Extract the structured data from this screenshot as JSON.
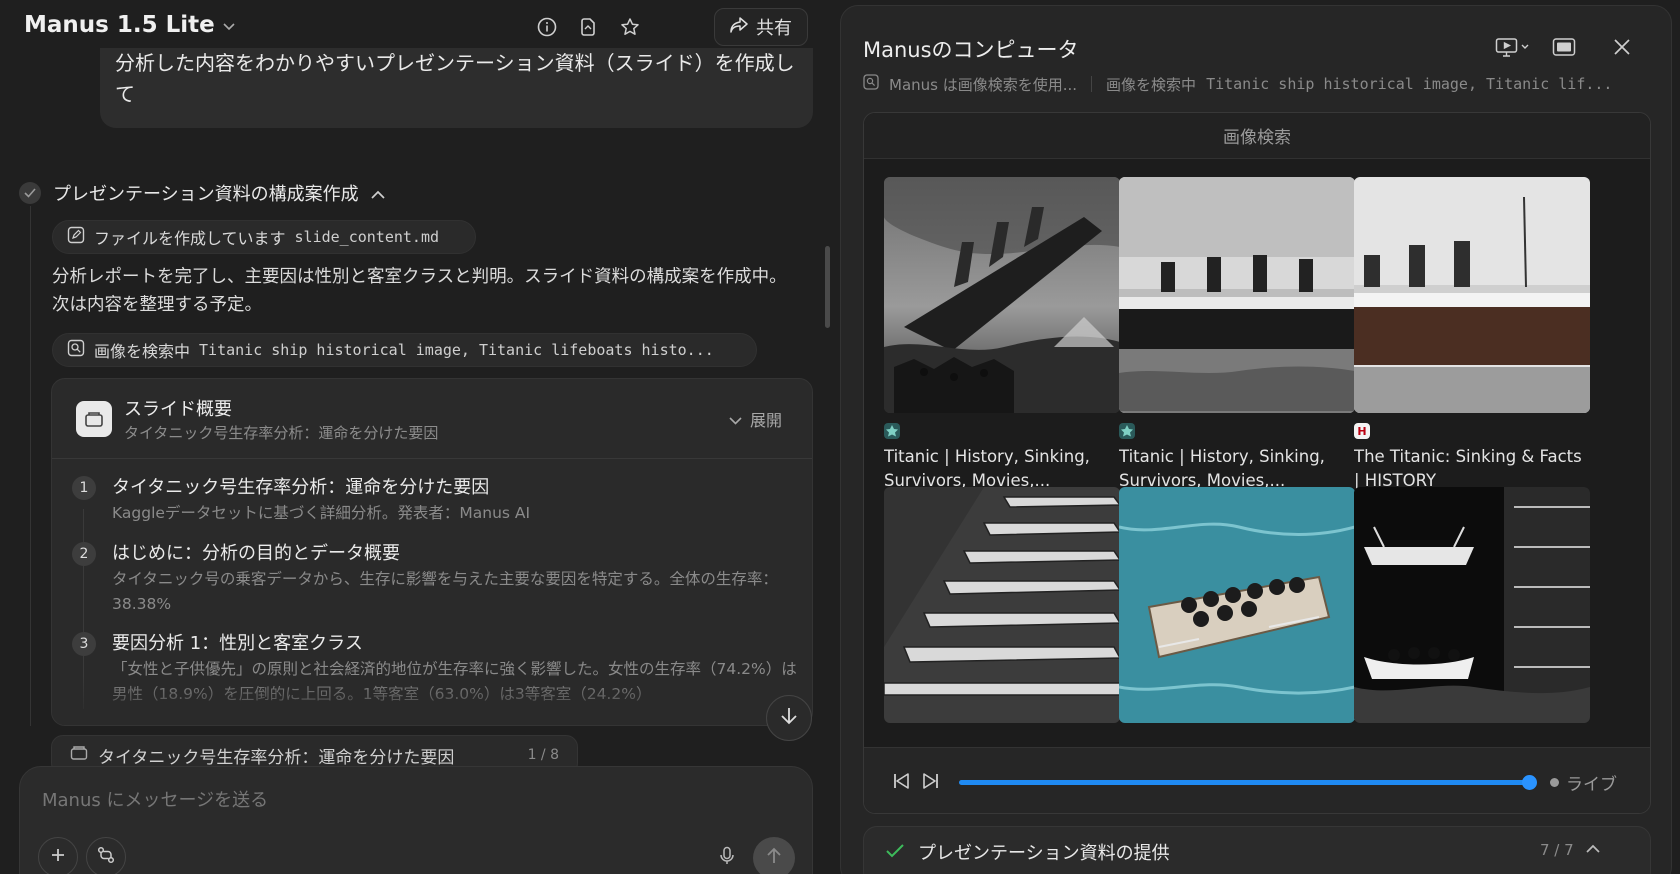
{
  "header": {
    "model_name": "Manus 1.5 Lite",
    "share_label": "共有"
  },
  "chat": {
    "user_message": "分析した内容をわかりやすいプレゼンテーション資料（スライド）を作成して",
    "step": {
      "title": "プレゼンテーション資料の構成案作成",
      "file_chip": {
        "label": "ファイルを作成しています",
        "filename": "slide_content.md"
      },
      "status": "分析レポートを完了し、主要因は性別と客室クラスと判明。スライド資料の構成案を作成中。次は内容を整理する予定。",
      "search_chip": {
        "label": "画像を検索中",
        "query": "Titanic ship historical image, Titanic lifeboats histo..."
      }
    },
    "slide_card": {
      "title": "スライド概要",
      "subtitle": "タイタニック号生存率分析：運命を分けた要因",
      "expand_label": "展開",
      "items": [
        {
          "num": "1",
          "title": "タイタニック号生存率分析：運命を分けた要因",
          "desc": "Kaggleデータセットに基づく詳細分析。発表者：Manus AI"
        },
        {
          "num": "2",
          "title": "はじめに：分析の目的とデータ概要",
          "desc": "タイタニック号の乗客データから、生存に影響を与えた主要な要因を特定する。全体の生存率：38.38%"
        },
        {
          "num": "3",
          "title": "要因分析 1：性別と客室クラス",
          "desc": "「女性と子供優先」の原則と社会経済的地位が生存率に強く影響した。女性の生存率（74.2%）は男性（18.9%）を圧倒的に上回る。1等客室（63.0%）は3等客室（24.2%）"
        }
      ]
    },
    "mini_card": {
      "title": "タイタニック号生存率分析：運命を分けた要因",
      "count": "1 / 8"
    }
  },
  "composer": {
    "placeholder": "Manus にメッセージを送る"
  },
  "computer": {
    "title": "Manusのコンピュータ",
    "sub_status": "Manus は画像検索を使用...",
    "sub_action": "画像を検索中",
    "sub_query": "Titanic ship historical image, Titanic lif...",
    "browser_title": "画像検索",
    "results": [
      {
        "title": "Titanic | History, Sinking, Survivors, Movies,...",
        "favicon": "britannica-icon"
      },
      {
        "title": "Titanic | History, Sinking, Survivors, Movies,...",
        "favicon": "britannica-icon"
      },
      {
        "title": "The Titanic: Sinking & Facts | HISTORY",
        "favicon": "history-icon",
        "favicon_text": "H"
      },
      {
        "title": ""
      },
      {
        "title": ""
      },
      {
        "title": ""
      }
    ],
    "player": {
      "progress": 0.99,
      "live_label": "ライブ"
    }
  },
  "task": {
    "label": "プレゼンテーション資料の提供",
    "count": "7 / 7"
  },
  "colors": {
    "accent": "#1f8af2",
    "success": "#3dbb5b",
    "background": "#1f1f1f",
    "panel": "#262626"
  }
}
